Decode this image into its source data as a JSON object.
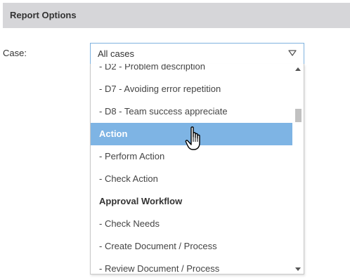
{
  "panel": {
    "title": "Report Options"
  },
  "case_field": {
    "label": "Case:",
    "selected_value": "All cases"
  },
  "dropdown": {
    "options": [
      {
        "label": "- D2 - Problem description",
        "group": false,
        "highlighted": false
      },
      {
        "label": "- D7 - Avoiding error repetition",
        "group": false,
        "highlighted": false
      },
      {
        "label": "- D8 - Team success appreciate",
        "group": false,
        "highlighted": false
      },
      {
        "label": "Action",
        "group": true,
        "highlighted": true
      },
      {
        "label": "- Perform Action",
        "group": false,
        "highlighted": false
      },
      {
        "label": "- Check Action",
        "group": false,
        "highlighted": false
      },
      {
        "label": "Approval Workflow",
        "group": true,
        "highlighted": false
      },
      {
        "label": "- Check Needs",
        "group": false,
        "highlighted": false
      },
      {
        "label": "- Create Document / Process",
        "group": false,
        "highlighted": false
      },
      {
        "label": "- Review Document / Process",
        "group": false,
        "highlighted": false
      }
    ]
  },
  "icons": {
    "select_arrow": "chevron-down-icon",
    "scroll_up": "scroll-up-arrow-icon",
    "scroll_down": "scroll-down-arrow-icon",
    "cursor": "hand-pointer-cursor-icon"
  },
  "colors": {
    "header_bg": "#d6d6d9",
    "highlight": "#7eb4e4",
    "select_border": "#7fb2df"
  }
}
